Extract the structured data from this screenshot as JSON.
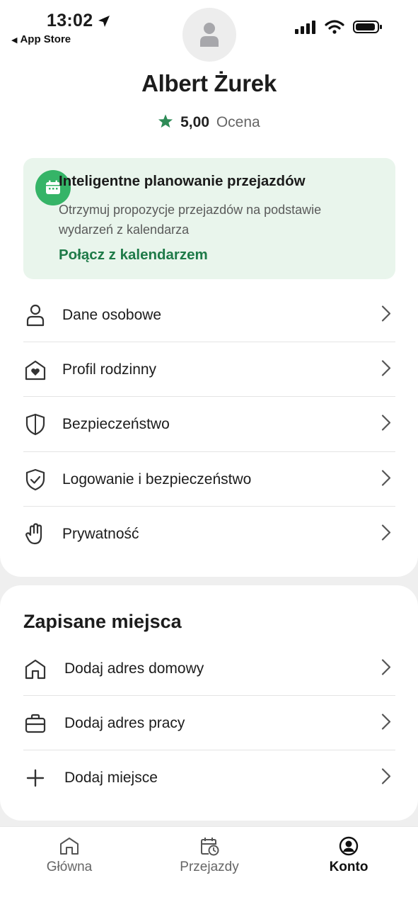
{
  "status_bar": {
    "time": "13:02",
    "back_label": "App Store"
  },
  "profile": {
    "name": "Albert Żurek",
    "rating_value": "5,00",
    "rating_label": "Ocena"
  },
  "promo": {
    "title": "Inteligentne planowanie przejazdów",
    "description": "Otrzymuj propozycje przejazdów na podstawie wydarzeń z kalendarza",
    "link": "Połącz z kalendarzem",
    "accent_color": "#35b467",
    "link_color": "#1e7a48"
  },
  "account_menu": [
    {
      "label": "Dane osobowe",
      "icon": "person-icon"
    },
    {
      "label": "Profil rodzinny",
      "icon": "family-house-icon"
    },
    {
      "label": "Bezpieczeństwo",
      "icon": "shield-icon"
    },
    {
      "label": "Logowanie i bezpieczeństwo",
      "icon": "shield-check-icon"
    },
    {
      "label": "Prywatność",
      "icon": "hand-icon"
    }
  ],
  "saved_places": {
    "title": "Zapisane miejsca",
    "items": [
      {
        "label": "Dodaj adres domowy",
        "icon": "home-icon"
      },
      {
        "label": "Dodaj adres pracy",
        "icon": "briefcase-icon"
      },
      {
        "label": "Dodaj miejsce",
        "icon": "plus-icon"
      }
    ]
  },
  "tabbar": [
    {
      "label": "Główna",
      "icon": "home-icon",
      "active": false
    },
    {
      "label": "Przejazdy",
      "icon": "calendar-clock-icon",
      "active": false
    },
    {
      "label": "Konto",
      "icon": "account-circle-icon",
      "active": true
    }
  ]
}
